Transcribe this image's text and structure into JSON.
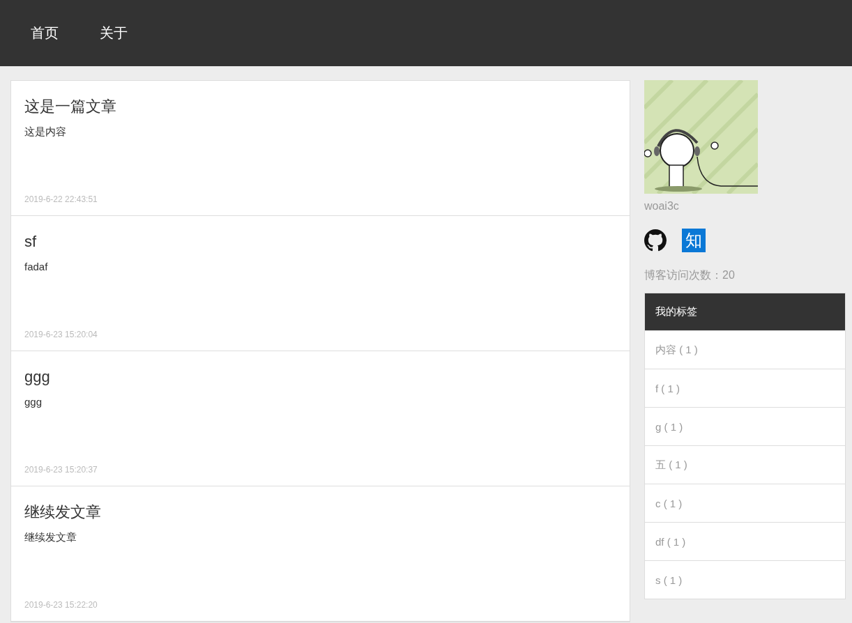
{
  "nav": [
    {
      "label": "首页"
    },
    {
      "label": "关于"
    }
  ],
  "articles": [
    {
      "title": "这是一篇文章",
      "content": "这是内容",
      "date": "2019-6-22 22:43:51"
    },
    {
      "title": "sf",
      "content": "fadaf",
      "date": "2019-6-23 15:20:04"
    },
    {
      "title": "ggg",
      "content": "ggg",
      "date": "2019-6-23 15:20:37"
    },
    {
      "title": "继续发文章",
      "content": "继续发文章",
      "date": "2019-6-23 15:22:20"
    }
  ],
  "profile": {
    "name": "woai3c",
    "zhihu_icon": "知",
    "visits": "博客访问次数：20"
  },
  "tags": {
    "title": "我的标签",
    "items": [
      {
        "label": "内容 ( 1 )"
      },
      {
        "label": "f ( 1 )"
      },
      {
        "label": "g ( 1 )"
      },
      {
        "label": "五 ( 1 )"
      },
      {
        "label": "c ( 1 )"
      },
      {
        "label": "df ( 1 )"
      },
      {
        "label": "s ( 1 )"
      }
    ]
  }
}
